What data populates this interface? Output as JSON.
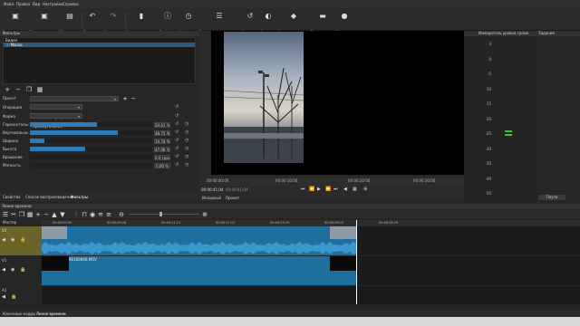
{
  "menu": [
    "Файл",
    "Правка",
    "Вид",
    "Настройки",
    "Справка"
  ],
  "toolbar": [
    {
      "label": "Открыть файл",
      "icon": "folder-open-icon",
      "glyph": "▣"
    },
    {
      "label": "Открыть другой...",
      "icon": "folder-open-other-icon",
      "glyph": "▣"
    },
    {
      "label": "Сохранить",
      "icon": "save-icon",
      "glyph": "▤"
    },
    {
      "label": "Отменить",
      "icon": "undo-icon",
      "glyph": "↶"
    },
    {
      "label": "Повторить",
      "icon": "redo-icon",
      "glyph": "↷"
    },
    {
      "label": "Измерители уровня",
      "icon": "level-meter-icon",
      "glyph": "▮"
    },
    {
      "label": "Свойства",
      "icon": "properties-icon",
      "glyph": "ⓘ"
    },
    {
      "label": "Недавние",
      "icon": "recent-icon",
      "glyph": "◷"
    },
    {
      "label": "Список воспроизведения",
      "icon": "playlist-icon",
      "glyph": "☰"
    },
    {
      "label": "История",
      "icon": "history-icon",
      "glyph": "↺"
    },
    {
      "label": "Фильтры",
      "icon": "filters-icon",
      "glyph": "◐"
    },
    {
      "label": "Ключевые кадры",
      "icon": "keyframes-icon",
      "glyph": "◆"
    },
    {
      "label": "Линия времени",
      "icon": "timeline-icon",
      "glyph": "▬"
    },
    {
      "label": "Экспорт",
      "icon": "export-icon",
      "glyph": "●"
    }
  ],
  "filters_panel": {
    "title": "Фильтры",
    "clip_name": "90160646.MOV",
    "group_label": "Видео",
    "items": [
      "✓ Маска"
    ],
    "preset_label": "Пресет",
    "operation_label": "Операция",
    "operation_value": "Запись на прозрачном",
    "shape_label": "Форма",
    "shape_value": "Прямоугольник",
    "sliders": [
      {
        "label": "Горизонтальная",
        "value": "20,61 %",
        "fraction": 0.55
      },
      {
        "label": "Вертикальная",
        "value": "48,75 %",
        "fraction": 0.72
      },
      {
        "label": "Ширина",
        "value": "10,78 %",
        "fraction": 0.12
      },
      {
        "label": "Высота",
        "value": "47,08 %",
        "fraction": 0.45
      },
      {
        "label": "Вращение",
        "value": "0,0 град",
        "fraction": 0.0
      },
      {
        "label": "Мягкость",
        "value": "0,00 %",
        "fraction": 0.0
      }
    ],
    "tabs": [
      "Свойства",
      "Список воспроизведения",
      "Фильтры"
    ]
  },
  "player": {
    "ruler_ticks": [
      "00:00:00:00",
      "00:00:10:00",
      "00:00:20:00",
      "00:00:30:00"
    ],
    "position": "00:00:41;04",
    "duration": "00:00:41;04",
    "tabs": [
      "Исходный",
      "Проект"
    ]
  },
  "meter": {
    "title": "Измеритель уровня громк",
    "scale": [
      "3",
      "0",
      "-5",
      "-10",
      "-15",
      "-20",
      "-25",
      "-30",
      "-35",
      "-40",
      "-50"
    ]
  },
  "history": {
    "title": "Задание",
    "button": "Пауза"
  },
  "timeline": {
    "title": "Линия времени",
    "master_label": "Мастер",
    "ruler_ticks": [
      "00:00:00:00",
      "00:00:05:28",
      "00:00:11:21",
      "00:00:17:17",
      "00:00:23:15",
      "00:00:29:13",
      "00:00:35:15"
    ],
    "tracks": [
      {
        "name": "V2",
        "type": "video"
      },
      {
        "name": "V1",
        "type": "video"
      },
      {
        "name": "A1",
        "type": "audio"
      }
    ],
    "clip_label": "90160646.MOV"
  },
  "status_tabs": [
    "Ключевые кадры",
    "Линия времени"
  ],
  "colors": {
    "accent": "#2f7bb8",
    "selected_track": "#6b6327",
    "clip": "#1f6f9e"
  }
}
